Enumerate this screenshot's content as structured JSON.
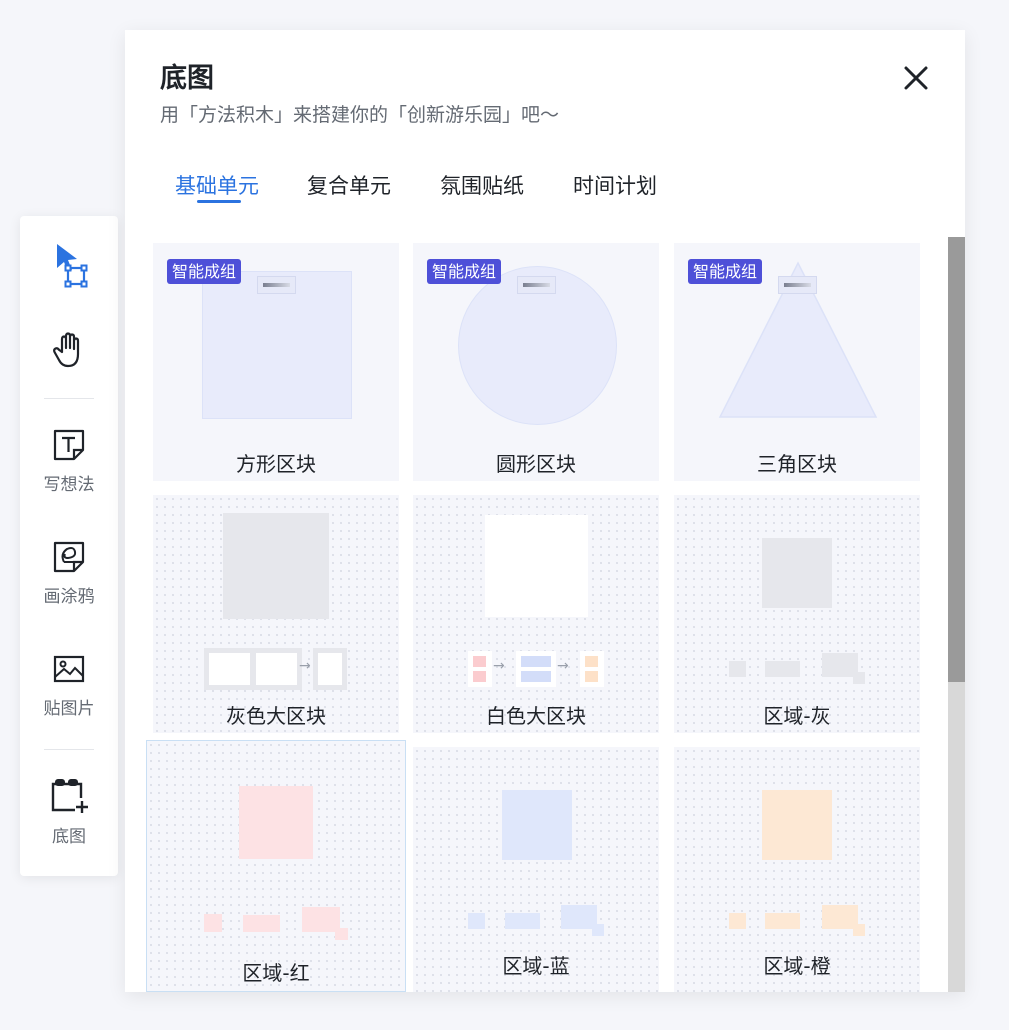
{
  "toolbar": {
    "items": [
      {
        "name": "select",
        "label": ""
      },
      {
        "name": "hand",
        "label": ""
      },
      {
        "name": "text",
        "label": "写想法"
      },
      {
        "name": "draw",
        "label": "画涂鸦"
      },
      {
        "name": "image",
        "label": "贴图片"
      },
      {
        "name": "frame",
        "label": "底图"
      }
    ],
    "active_color": "#2b73e0"
  },
  "panel": {
    "title": "底图",
    "subtitle": "用「方法积木」来搭建你的「创新游乐园」吧〜"
  },
  "tabs": [
    {
      "label": "基础单元",
      "active": true
    },
    {
      "label": "复合单元",
      "active": false
    },
    {
      "label": "氛围贴纸",
      "active": false
    },
    {
      "label": "时间计划",
      "active": false
    }
  ],
  "badge_label": "智能成组",
  "cards": [
    {
      "label": "方形区块",
      "badge": true
    },
    {
      "label": "圆形区块",
      "badge": true
    },
    {
      "label": "三角区块",
      "badge": true
    },
    {
      "label": "灰色大区块",
      "badge": false
    },
    {
      "label": "白色大区块",
      "badge": false
    },
    {
      "label": "区域-灰",
      "badge": false
    },
    {
      "label": "区域-红",
      "badge": false,
      "selected": true
    },
    {
      "label": "区域-蓝",
      "badge": false
    },
    {
      "label": "区域-橙",
      "badge": false
    }
  ],
  "colors": {
    "badge": "#4e50d8",
    "region_gray": "#e6e7ec",
    "region_red": "#fde2e4",
    "region_blue": "#dfe7fb",
    "region_orange": "#fde8d4"
  }
}
